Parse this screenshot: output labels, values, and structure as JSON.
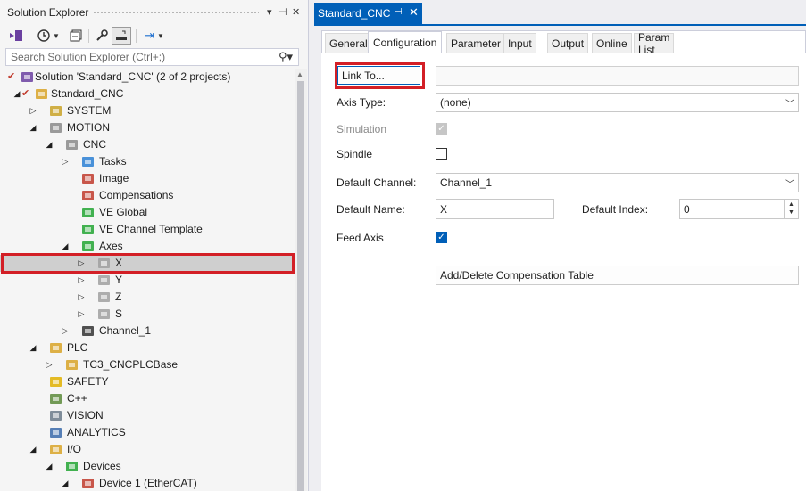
{
  "solution_explorer": {
    "title": "Solution Explorer",
    "controls": {
      "dropdown": "▾",
      "pin": "⊣",
      "close": "✕"
    },
    "search_placeholder": "Search Solution Explorer (Ctrl+;)",
    "tree": [
      {
        "label": "Solution 'Standard_CNC' (2 of 2 projects)",
        "icon": "solution-icon",
        "expander": ""
      },
      {
        "label": "Standard_CNC",
        "icon": "project-icon",
        "expander": "◢"
      },
      {
        "label": "SYSTEM",
        "icon": "system-icon",
        "expander": "▷"
      },
      {
        "label": "MOTION",
        "icon": "motion-icon",
        "expander": "◢"
      },
      {
        "label": "CNC",
        "icon": "cnc-icon",
        "expander": "◢"
      },
      {
        "label": "Tasks",
        "icon": "tasks-icon",
        "expander": "▷"
      },
      {
        "label": "Image",
        "icon": "image-icon",
        "expander": ""
      },
      {
        "label": "Compensations",
        "icon": "compensations-icon",
        "expander": ""
      },
      {
        "label": "VE Global",
        "icon": "ve-global-icon",
        "expander": ""
      },
      {
        "label": "VE Channel Template",
        "icon": "ve-channel-template-icon",
        "expander": ""
      },
      {
        "label": "Axes",
        "icon": "axes-icon",
        "expander": "◢"
      },
      {
        "label": "X",
        "icon": "axis-icon",
        "expander": "▷"
      },
      {
        "label": "Y",
        "icon": "axis-icon",
        "expander": "▷"
      },
      {
        "label": "Z",
        "icon": "axis-icon",
        "expander": "▷"
      },
      {
        "label": "S",
        "icon": "axis-icon",
        "expander": "▷"
      },
      {
        "label": "Channel_1",
        "icon": "channel-icon",
        "expander": "▷"
      },
      {
        "label": "PLC",
        "icon": "plc-icon",
        "expander": "◢"
      },
      {
        "label": "TC3_CNCPLCBase",
        "icon": "plc-project-icon",
        "expander": "▷"
      },
      {
        "label": "SAFETY",
        "icon": "safety-icon",
        "expander": ""
      },
      {
        "label": "C++",
        "icon": "cpp-icon",
        "expander": ""
      },
      {
        "label": "VISION",
        "icon": "vision-icon",
        "expander": ""
      },
      {
        "label": "ANALYTICS",
        "icon": "analytics-icon",
        "expander": ""
      },
      {
        "label": "I/O",
        "icon": "io-icon",
        "expander": "◢"
      },
      {
        "label": "Devices",
        "icon": "devices-icon",
        "expander": "◢"
      },
      {
        "label": "Device 1 (EtherCAT)",
        "icon": "ethercat-icon",
        "expander": "◢"
      }
    ]
  },
  "document": {
    "tab_title": "Standard_CNC",
    "tab_pin": "⊣",
    "tab_close": "✕",
    "tabs": [
      "General",
      "Configuration",
      "Parameter",
      "Input",
      "Output",
      "Online",
      "Param List"
    ],
    "form": {
      "link_button": "Link To...",
      "link_value": "",
      "axis_type_label": "Axis Type:",
      "axis_type_value": "(none)",
      "simulation_label": "Simulation",
      "spindle_label": "Spindle",
      "default_channel_label": "Default Channel:",
      "default_channel_value": "Channel_1",
      "default_name_label": "Default Name:",
      "default_name_value": "X",
      "default_index_label": "Default Index:",
      "default_index_value": "0",
      "feed_axis_label": "Feed Axis",
      "comp_button": "Add/Delete Compensation Table"
    }
  }
}
